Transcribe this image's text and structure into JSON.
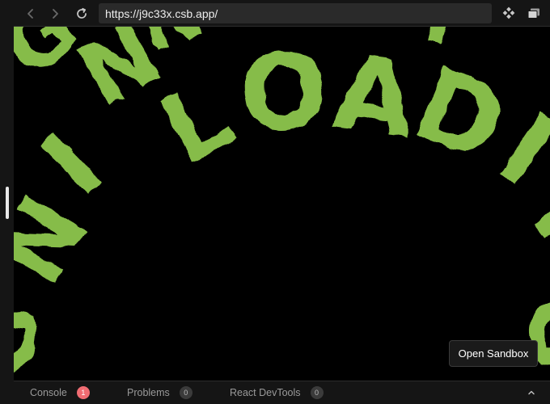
{
  "browser": {
    "url": "https://j9c33x.csb.app/",
    "back_icon": "chevron-left-icon",
    "forward_icon": "chevron-right-icon",
    "refresh_icon": "refresh-icon",
    "devtools_icon": "diamond-grid-icon",
    "windows_icon": "stacked-windows-icon"
  },
  "preview": {
    "loader_letters": [
      "L",
      "O",
      "A",
      "D",
      "I",
      "N",
      "G",
      "L",
      "O",
      "A",
      "D",
      "I",
      "N",
      "G"
    ],
    "loader_color": "#86bc4a",
    "background": "#000000"
  },
  "open_sandbox_label": "Open Sandbox",
  "bottom_tabs": [
    {
      "label": "Console",
      "count": "1",
      "badge_color": "#f06c72"
    },
    {
      "label": "Problems",
      "count": "0",
      "badge_color": "#3b3b3b"
    },
    {
      "label": "React DevTools",
      "count": "0",
      "badge_color": "#3b3b3b"
    }
  ],
  "collapse_icon": "chevron-up-icon"
}
